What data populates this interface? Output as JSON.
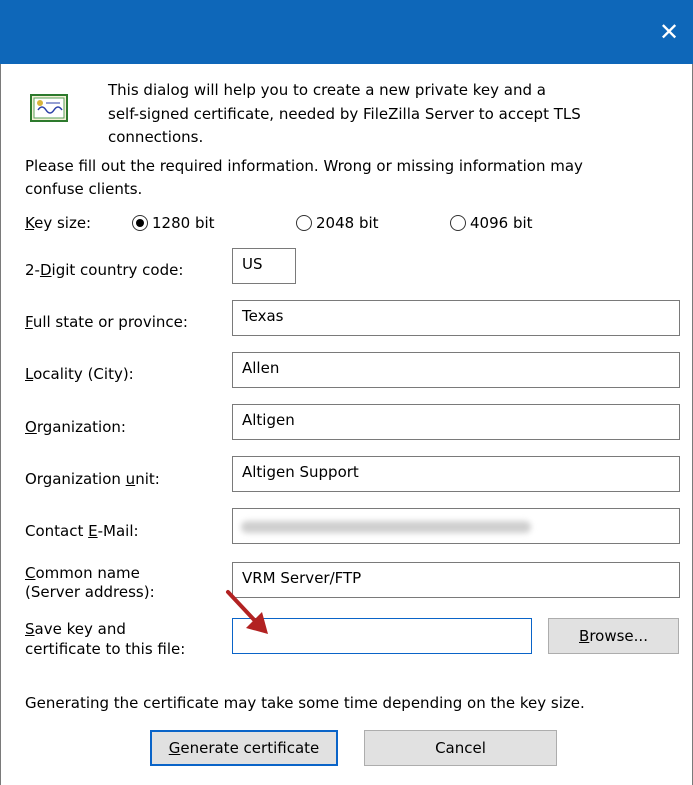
{
  "window": {
    "close_glyph": "✕"
  },
  "intro": {
    "line1": "This dialog will help you to create a new private key and a",
    "line2": "self-signed certificate, needed by FileZilla Server to accept TLS",
    "line3": "connections."
  },
  "notice": {
    "line1": "Please fill out the required information. Wrong or missing information may",
    "line2": "confuse clients."
  },
  "key_size": {
    "label_ul": "K",
    "label_rest": "ey size:",
    "options": [
      {
        "label": "1280 bit",
        "selected": true
      },
      {
        "label": "2048 bit",
        "selected": false
      },
      {
        "label": "4096 bit",
        "selected": false
      }
    ]
  },
  "fields": {
    "country": {
      "label_pre": "2-",
      "label_ul": "D",
      "label_post": "igit country code:",
      "value": "US"
    },
    "state": {
      "label_pre": "",
      "label_ul": "F",
      "label_post": "ull state or province:",
      "value": "Texas"
    },
    "city": {
      "label_pre": "",
      "label_ul": "L",
      "label_post": "ocality (City):",
      "value": "Allen"
    },
    "org": {
      "label_pre": "",
      "label_ul": "O",
      "label_post": "rganization:",
      "value": "Altigen"
    },
    "org_unit": {
      "label_pre": "Organization ",
      "label_ul": "u",
      "label_post": "nit:",
      "value": "Altigen Support"
    },
    "email": {
      "label_pre": "Contact ",
      "label_ul": "E",
      "label_post": "-Mail:",
      "value": ""
    },
    "common_name": {
      "label_line1_ul": "C",
      "label_line1_rest": "ommon name",
      "label_line2": "(Server address):",
      "value": "VRM Server/FTP"
    },
    "save_file": {
      "label_line1_ul": "S",
      "label_line1_rest": "ave key and",
      "label_line2": "certificate to this file:",
      "value": ""
    }
  },
  "browse": {
    "ul": "B",
    "rest": "rowse..."
  },
  "footer_note": "Generating the certificate may take some time depending on the key size.",
  "buttons": {
    "generate_ul": "G",
    "generate_rest": "enerate certificate",
    "cancel": "Cancel"
  },
  "colors": {
    "titlebar": "#0e67b9",
    "focus": "#0a64c8",
    "arrow": "#b22222"
  }
}
